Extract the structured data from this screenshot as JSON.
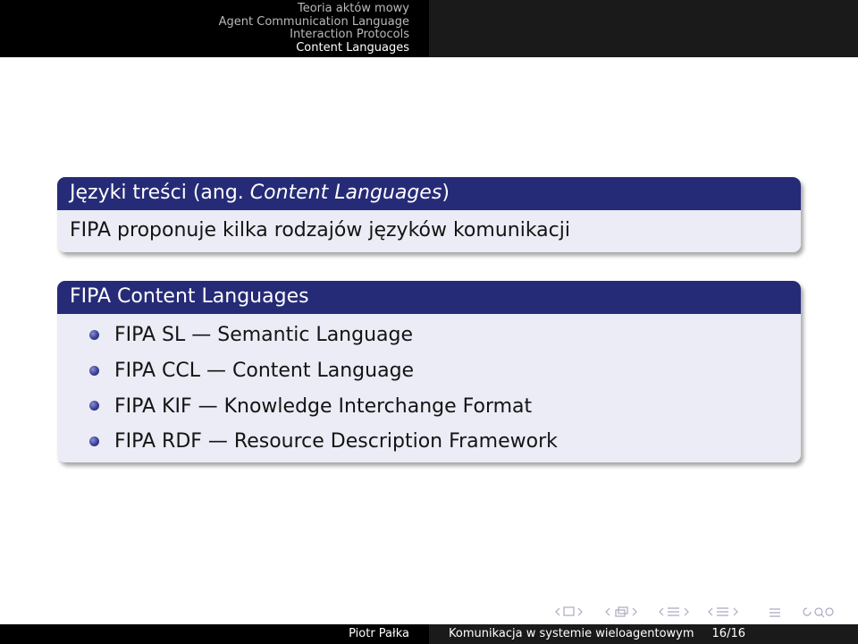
{
  "header": {
    "nav": [
      "Teoria aktów mowy",
      "Agent Communication Language",
      "Interaction Protocols",
      "Content Languages"
    ]
  },
  "block1": {
    "title_prefix": "Języki treści (ang. ",
    "title_italic": "Content Languages",
    "title_suffix": ")",
    "body": "FIPA proponuje kilka rodzajów języków komunikacji"
  },
  "block2": {
    "title": "FIPA Content Languages",
    "items": [
      "FIPA SL — Semantic Language",
      "FIPA CCL — Content Language",
      "FIPA KIF — Knowledge Interchange Format",
      "FIPA RDF — Resource Description Framework"
    ]
  },
  "footer": {
    "author": "Piotr Pałka",
    "title": "Komunikacja w systemie wieloagentowym",
    "page": "16/16"
  },
  "nav_icons": [
    "frame-prev-icon",
    "frame-next-icon",
    "subsection-prev-icon",
    "subsection-next-icon",
    "section-prev-icon",
    "section-next-icon",
    "align-icon",
    "search-icon"
  ]
}
